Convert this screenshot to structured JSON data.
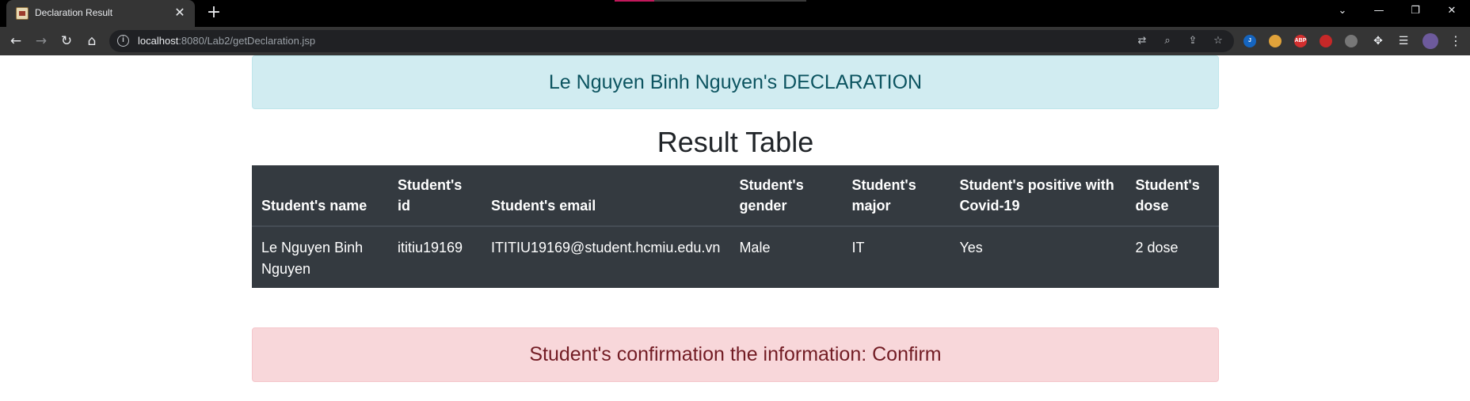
{
  "browser": {
    "tab_title": "Declaration Result",
    "tab_close": "✕",
    "new_tab": "+",
    "url_host": "localhost",
    "url_rest": ":8080/Lab2/getDeclaration.jsp",
    "window_controls": {
      "tab_search": "⌄",
      "minimize": "—",
      "restore": "❐",
      "close": "✕"
    },
    "nav": {
      "back": "←",
      "forward": "→",
      "reload": "↻",
      "home": "⌂"
    },
    "extensions": [
      {
        "name": "j-extension-icon",
        "label": "J",
        "color": "#1565c0"
      },
      {
        "name": "honey-extension-icon",
        "label": "",
        "color": "#e0a23a"
      },
      {
        "name": "adblock-plus-icon",
        "label": "ABP",
        "color": "#d32f2f"
      },
      {
        "name": "hand-block-icon",
        "label": "",
        "color": "#c62828"
      },
      {
        "name": "tampermonkey-icon",
        "label": "",
        "color": "#777777"
      }
    ]
  },
  "page": {
    "info_alert": "Le Nguyen Binh Nguyen's DECLARATION",
    "heading": "Result Table",
    "table": {
      "headers": [
        "Student's name",
        "Student's id",
        "Student's email",
        "Student's gender",
        "Student's major",
        "Student's positive with Covid-19",
        "Student's dose"
      ],
      "rows": [
        [
          "Le Nguyen Binh Nguyen",
          "ititiu19169",
          "ITITIU19169@student.hcmiu.edu.vn",
          "Male",
          "IT",
          "Yes",
          "2 dose"
        ]
      ]
    },
    "danger_alert": "Student's confirmation the information: Confirm"
  },
  "colors": {
    "info_bg": "#d1ecf1",
    "info_text": "#0c5460",
    "table_dark": "#343a40",
    "danger_bg": "#f8d7da",
    "danger_text": "#721c24"
  }
}
